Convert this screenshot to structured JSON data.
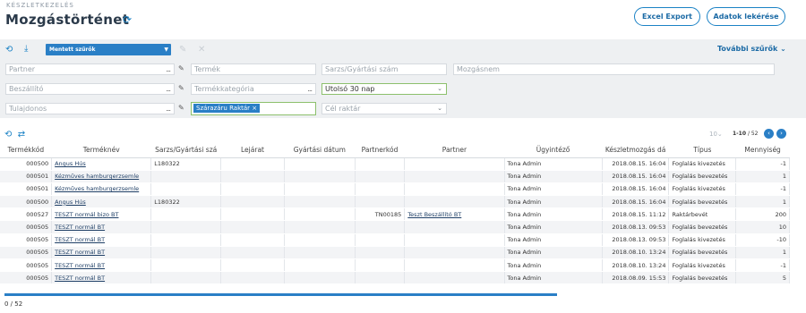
{
  "header": {
    "breadcrumb": "KÉSZLETKEZELÉS",
    "title": "Mozgástörténet",
    "excel_label": "Excel Export",
    "fetch_label": "Adatok lekérése"
  },
  "filters": {
    "saved_filters_label": "Mentett szűrők",
    "more_filters_label": "További szűrők",
    "partner_placeholder": "Partner",
    "termek_placeholder": "Termék",
    "sarzs_placeholder": "Sarzs/Gyártási szám",
    "mozgasnem_placeholder": "Mozgásnem",
    "beszallito_placeholder": "Beszállító",
    "termekkategoria_placeholder": "Termékkategória",
    "period_value": "Utolsó 30 nap",
    "tulajdonos_placeholder": "Tulajdonos",
    "warehouse_tag": "Szárazáru Raktár",
    "cel_raktar_placeholder": "Cél raktár"
  },
  "pager": {
    "page_size": "10",
    "range": "1-10",
    "total": "/ 52"
  },
  "table": {
    "columns": [
      "Termékkód",
      "Terméknév",
      "Sarzs/Gyártási szá",
      "Lejárat",
      "Gyártási dátum",
      "Partnerkód",
      "Partner",
      "Ügyintéző",
      "Készletmozgás dá",
      "Típus",
      "Mennyiség"
    ],
    "rows": [
      [
        "000500",
        "Angus Hús",
        "L180322",
        "",
        "",
        "",
        "",
        "Tona Admin",
        "2018.08.15. 16:04",
        "Foglalás kivezetés",
        "-1"
      ],
      [
        "000501",
        "Kézműves hamburgerzsemle",
        "",
        "",
        "",
        "",
        "",
        "Tona Admin",
        "2018.08.15. 16:04",
        "Foglalás bevezetés",
        "1"
      ],
      [
        "000501",
        "Kézműves hamburgerzsemle",
        "",
        "",
        "",
        "",
        "",
        "Tona Admin",
        "2018.08.15. 16:04",
        "Foglalás kivezetés",
        "-1"
      ],
      [
        "000500",
        "Angus Hús",
        "L180322",
        "",
        "",
        "",
        "",
        "Tona Admin",
        "2018.08.15. 16:04",
        "Foglalás bevezetés",
        "1"
      ],
      [
        "000527",
        "TESZT normál bizo BT",
        "",
        "",
        "",
        "TN00185",
        "Teszt Beszállító BT",
        "Tona Admin",
        "2018.08.15. 11:12",
        "Raktárbevét",
        "200"
      ],
      [
        "000505",
        "TESZT normál BT",
        "",
        "",
        "",
        "",
        "",
        "Tona Admin",
        "2018.08.13. 09:53",
        "Foglalás bevezetés",
        "10"
      ],
      [
        "000505",
        "TESZT normál BT",
        "",
        "",
        "",
        "",
        "",
        "Tona Admin",
        "2018.08.13. 09:53",
        "Foglalás kivezetés",
        "-10"
      ],
      [
        "000505",
        "TESZT normál BT",
        "",
        "",
        "",
        "",
        "",
        "Tona Admin",
        "2018.08.10. 13:24",
        "Foglalás bevezetés",
        "1"
      ],
      [
        "000505",
        "TESZT normál BT",
        "",
        "",
        "",
        "",
        "",
        "Tona Admin",
        "2018.08.10. 13:24",
        "Foglalás kivezetés",
        "-1"
      ],
      [
        "000505",
        "TESZT normál BT",
        "",
        "",
        "",
        "",
        "",
        "Tona Admin",
        "2018.08.09. 15:53",
        "Foglalás bevezetés",
        "5"
      ]
    ]
  },
  "footer": {
    "count": "0  /  52"
  }
}
